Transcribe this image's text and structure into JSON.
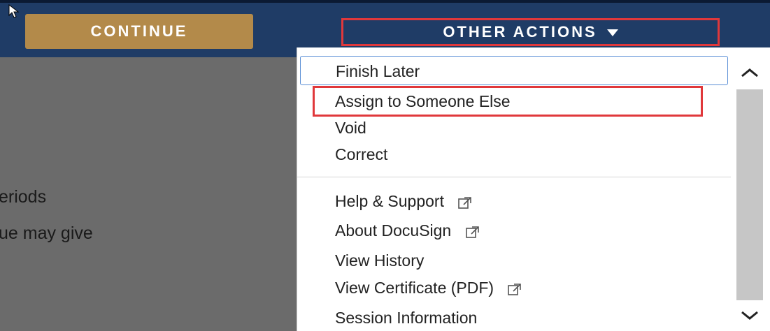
{
  "topbar": {
    "continue_label": "CONTINUE",
    "other_actions_label": "OTHER ACTIONS",
    "colors": {
      "bar": "#1f3c66",
      "continue": "#b38a4a",
      "highlight": "#e0383b"
    }
  },
  "background_text": {
    "line1": "eriods",
    "line2": "ue may give"
  },
  "menu": {
    "items": [
      {
        "label": "Finish Later"
      },
      {
        "label": "Assign to Someone Else"
      },
      {
        "label": "Void"
      },
      {
        "label": "Correct"
      },
      {
        "label": "Help & Support",
        "icon": "external-link-icon"
      },
      {
        "label": "About DocuSign",
        "icon": "external-link-icon"
      },
      {
        "label": "View History"
      },
      {
        "label": "View Certificate (PDF)",
        "icon": "external-link-icon"
      },
      {
        "label": "Session Information"
      }
    ]
  }
}
